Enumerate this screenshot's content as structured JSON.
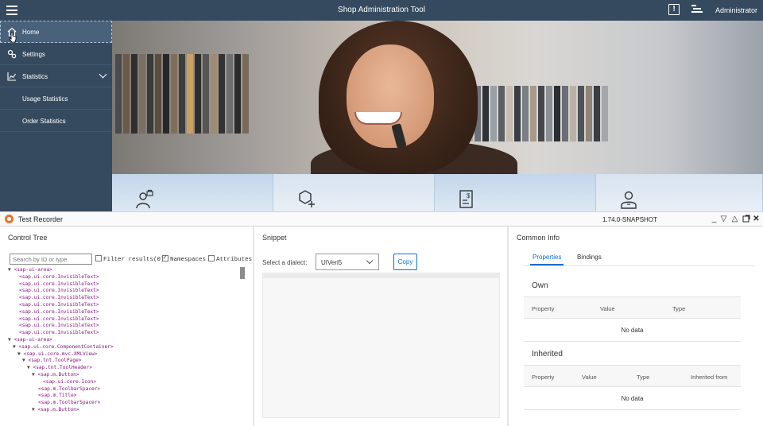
{
  "app": {
    "title": "Shop Administration Tool",
    "user": "Administrator",
    "alert_glyph": "!",
    "header_color": "#354a5f",
    "nav": [
      {
        "label": "Home",
        "icon": "home-icon"
      },
      {
        "label": "Settings",
        "icon": "settings-icon"
      },
      {
        "label": "Statistics",
        "icon": "chart-icon"
      },
      {
        "label": "Usage Statistics"
      },
      {
        "label": "Order Statistics"
      }
    ],
    "tiles": [
      "user-lock-icon",
      "add-product-icon",
      "document-money-icon",
      "employee-icon"
    ]
  },
  "recorder": {
    "title": "Test Recorder",
    "version": "1.74.0-SNAPSHOT",
    "window_controls": [
      "minimize-icon",
      "dock-icon",
      "expand-icon",
      "popout-icon",
      "close-icon"
    ],
    "control_tree": {
      "title": "Control Tree",
      "search_placeholder": "Search by ID or type",
      "filter_label": "Filter results(0)",
      "namespaces_label": "Namespaces",
      "attributes_label": "Attributes",
      "nodes": [
        {
          "indent": 0,
          "toggle": "▼",
          "text": "<sap-ui-area>"
        },
        {
          "indent": 1,
          "toggle": "",
          "text": "<sap.ui.core.InvisibleText>"
        },
        {
          "indent": 1,
          "toggle": "",
          "text": "<sap.ui.core.InvisibleText>"
        },
        {
          "indent": 1,
          "toggle": "",
          "text": "<sap.ui.core.InvisibleText>"
        },
        {
          "indent": 1,
          "toggle": "",
          "text": "<sap.ui.core.InvisibleText>"
        },
        {
          "indent": 1,
          "toggle": "",
          "text": "<sap.ui.core.InvisibleText>"
        },
        {
          "indent": 1,
          "toggle": "",
          "text": "<sap.ui.core.InvisibleText>"
        },
        {
          "indent": 1,
          "toggle": "",
          "text": "<sap.ui.core.InvisibleText>"
        },
        {
          "indent": 1,
          "toggle": "",
          "text": "<sap.ui.core.InvisibleText>"
        },
        {
          "indent": 1,
          "toggle": "",
          "text": "<sap.ui.core.InvisibleText>"
        },
        {
          "indent": 0,
          "toggle": "▼",
          "text": "<sap-ui-area>"
        },
        {
          "indent": 1,
          "toggle": "▼",
          "text": "<sap.ui.core.ComponentContainer>"
        },
        {
          "indent": 2,
          "toggle": "▼",
          "text": "<sap.ui.core.mvc.XMLView>"
        },
        {
          "indent": 3,
          "toggle": "▼",
          "text": "<sap.tnt.ToolPage>"
        },
        {
          "indent": 4,
          "toggle": "▼",
          "text": "<sap.tnt.ToolHeader>"
        },
        {
          "indent": 5,
          "toggle": "▼",
          "text": "<sap.m.Button>"
        },
        {
          "indent": 6,
          "toggle": "",
          "text": "<sap.ui.core.Icon>"
        },
        {
          "indent": 5,
          "toggle": "",
          "text": "<sap.m.ToolbarSpacer>"
        },
        {
          "indent": 5,
          "toggle": "",
          "text": "<sap.m.Title>"
        },
        {
          "indent": 5,
          "toggle": "",
          "text": "<sap.m.ToolbarSpacer>"
        },
        {
          "indent": 5,
          "toggle": "▼",
          "text": "<sap.m.Button>"
        }
      ]
    },
    "snippet": {
      "title": "Snippet",
      "dialect_label": "Select a dialect:",
      "dialect_value": "UIVeri5",
      "copy_label": "Copy"
    },
    "common_info": {
      "title": "Common Info",
      "tabs": [
        "Properties",
        "Bindings"
      ],
      "own_title": "Own",
      "own_columns": [
        "Property",
        "Value",
        "Type"
      ],
      "own_empty": "No data",
      "inherited_title": "Inherited",
      "inherited_columns": [
        "Property",
        "Value",
        "Type",
        "Inherited from"
      ],
      "inherited_empty": "No data"
    }
  }
}
